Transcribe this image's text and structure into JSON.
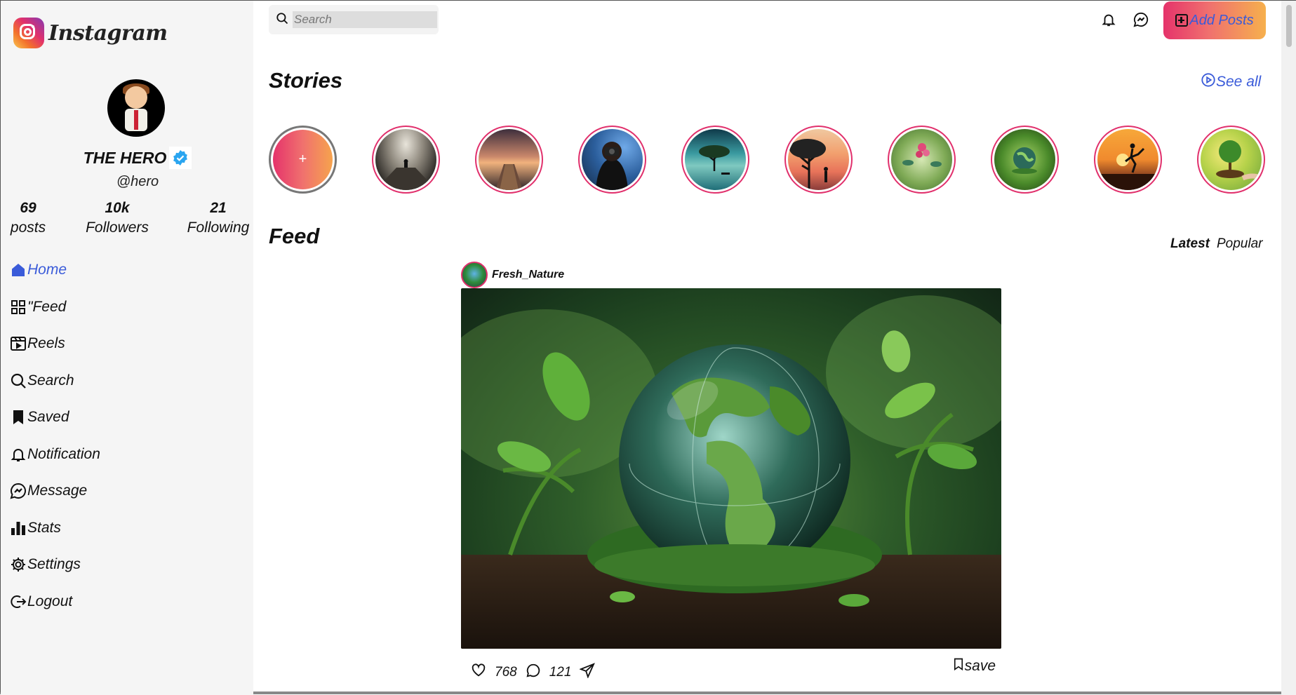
{
  "brand": {
    "name": "Instagram"
  },
  "profile": {
    "name": "THE HERO",
    "handle": "@hero",
    "stats": [
      {
        "value": "69",
        "label": "posts"
      },
      {
        "value": "10k",
        "label": "Followers"
      },
      {
        "value": "21",
        "label": "Following"
      }
    ]
  },
  "nav": [
    {
      "label": "Home",
      "icon": "home-icon",
      "active": true
    },
    {
      "label": "\"Feed",
      "icon": "grid-icon"
    },
    {
      "label": "Reels",
      "icon": "reels-icon"
    },
    {
      "label": "Search",
      "icon": "search-icon"
    },
    {
      "label": "Saved",
      "icon": "bookmark-icon"
    },
    {
      "label": "Notification",
      "icon": "bell-icon"
    },
    {
      "label": "Message",
      "icon": "messenger-icon"
    },
    {
      "label": "Stats",
      "icon": "bar-chart-icon"
    },
    {
      "label": "Settings",
      "icon": "gear-icon"
    },
    {
      "label": "Logout",
      "icon": "logout-icon"
    }
  ],
  "topbar": {
    "search_placeholder": "Search",
    "add_posts_label": "Add Posts"
  },
  "stories": {
    "title": "Stories",
    "see_all": "See all",
    "add_symbol": "+"
  },
  "feed": {
    "title": "Feed",
    "tabs": {
      "latest": "Latest",
      "popular": "Popular"
    },
    "post": {
      "username": "Fresh_Nature",
      "likes": "768",
      "comments": "121",
      "save_label": "save"
    }
  },
  "colors": {
    "accent": "#3a5bd9",
    "story_ring": "#e1306c",
    "sidebar_bg": "#f5f5f5"
  }
}
